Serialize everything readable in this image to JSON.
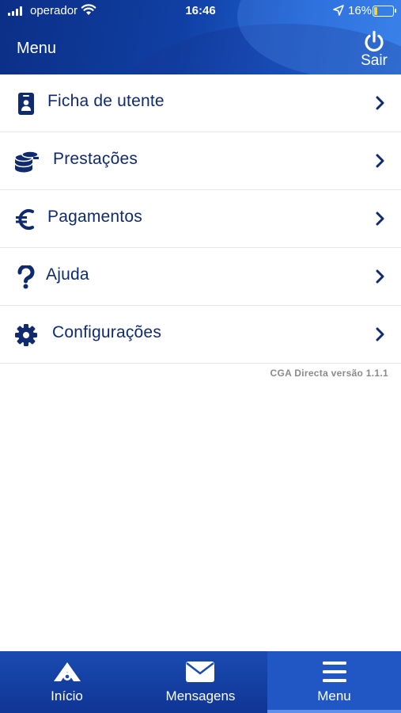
{
  "status_bar": {
    "carrier": "operador",
    "time": "16:46",
    "battery": "16%",
    "battery_level": 0.16
  },
  "header": {
    "title": "Menu",
    "logout_label": "Sair"
  },
  "menu": {
    "items": [
      {
        "label": "Ficha de utente",
        "icon": "id-badge-icon"
      },
      {
        "label": "Prestações",
        "icon": "coins-icon"
      },
      {
        "label": "Pagamentos",
        "icon": "euro-icon"
      },
      {
        "label": "Ajuda",
        "icon": "question-icon"
      },
      {
        "label": "Configurações",
        "icon": "gear-icon"
      }
    ]
  },
  "version": "CGA Directa versão 1.1.1",
  "tabbar": {
    "tabs": [
      {
        "label": "Início",
        "icon": "home-logo-icon"
      },
      {
        "label": "Mensagens",
        "icon": "envelope-icon"
      },
      {
        "label": "Menu",
        "icon": "hamburger-icon",
        "active": true
      }
    ]
  },
  "colors": {
    "primary_text": "#0f2a6e",
    "header_start": "#0b2f86",
    "header_end": "#2f7be8",
    "tabbar": "#1a4bb0",
    "battery": "#f4d33a"
  }
}
